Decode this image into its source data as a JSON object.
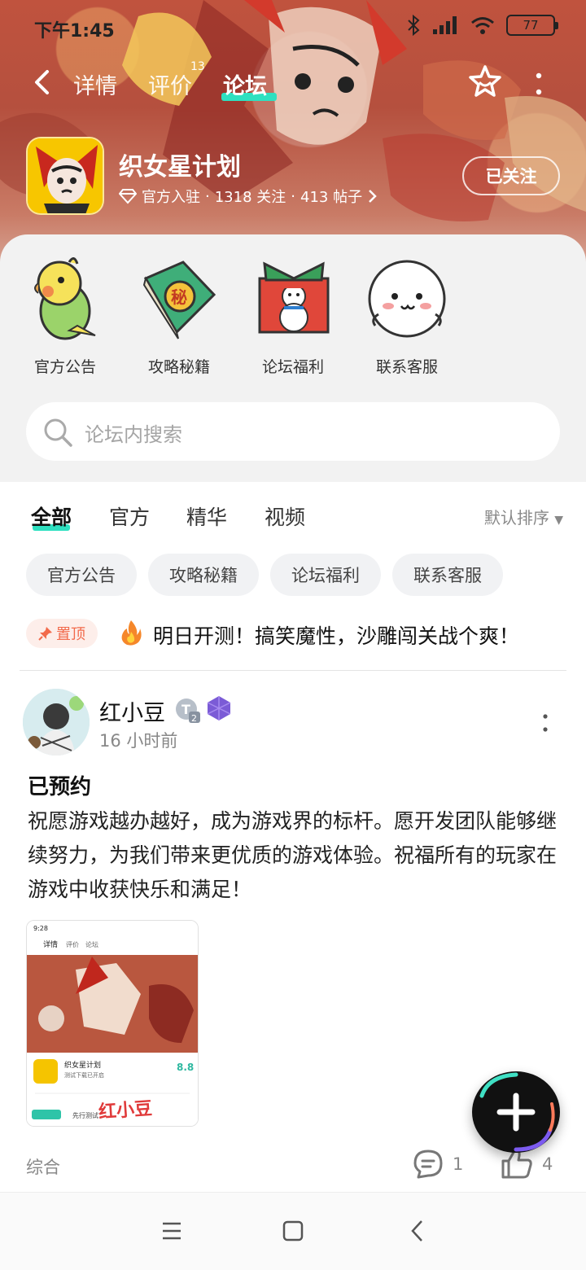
{
  "status_bar": {
    "time": "下午1:45",
    "battery": "77"
  },
  "top_nav": {
    "tabs": [
      {
        "label": "详情"
      },
      {
        "label": "评价",
        "count": "13"
      },
      {
        "label": "论坛"
      }
    ],
    "active_tab": "论坛"
  },
  "game": {
    "title": "织女星计划",
    "official": "官方入驻",
    "followers": "1318 关注",
    "posts": "413 帖子",
    "follow_label": "已关注"
  },
  "quick_entries": [
    {
      "label": "官方公告",
      "icon": "parrot-icon"
    },
    {
      "label": "攻略秘籍",
      "icon": "secret-book-icon"
    },
    {
      "label": "论坛福利",
      "icon": "gift-box-icon"
    },
    {
      "label": "联系客服",
      "icon": "ghost-support-icon"
    }
  ],
  "search": {
    "placeholder": "论坛内搜索"
  },
  "filter_tabs": [
    {
      "label": "全部",
      "active": true
    },
    {
      "label": "官方"
    },
    {
      "label": "精华"
    },
    {
      "label": "视频"
    }
  ],
  "sort_label": "默认排序",
  "chips": [
    "官方公告",
    "攻略秘籍",
    "论坛福利",
    "联系客服"
  ],
  "pinned": {
    "badge": "置顶",
    "text": "明日开测！搞笑魔性，沙雕闯关战个爽！"
  },
  "post": {
    "username": "红小豆",
    "time": "16 小时前",
    "title": "已预约",
    "body": "祝愿游戏越办越好，成为游戏界的标杆。愿开发团队能够继续努力，为我们带来更优质的游戏体验。祝福所有的玩家在游戏中收获快乐和满足！",
    "category": "综合",
    "comments": "1",
    "likes": "4",
    "screenshot": {
      "time": "9:28",
      "tabs": [
        "详情",
        "评价",
        "论坛"
      ],
      "title": "织女星计划",
      "subtitle": "测试下载已开启",
      "score": "8.8",
      "watermark": "红小豆",
      "btn": "先行测试"
    }
  },
  "colors": {
    "accent": "#2ee0c0",
    "pin": "#f26a4b"
  }
}
